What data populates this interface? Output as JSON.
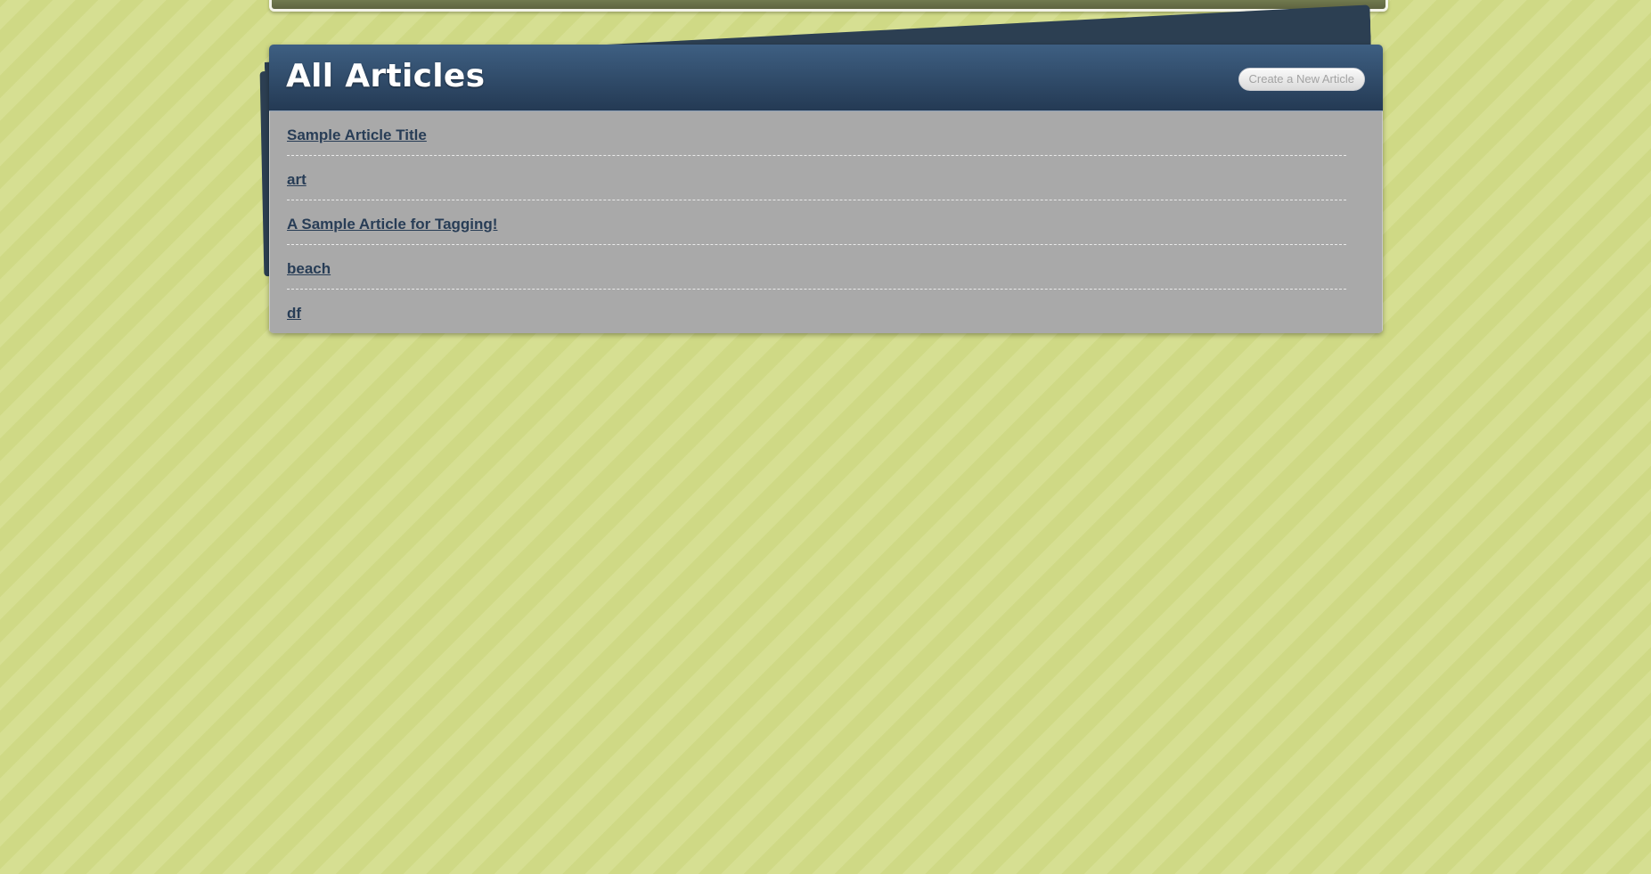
{
  "page": {
    "title": "All Articles",
    "create_button_label": "Create a New Article"
  },
  "articles": [
    {
      "title": "Sample Article Title"
    },
    {
      "title": "art"
    },
    {
      "title": "A Sample Article for Tagging!"
    },
    {
      "title": "beach"
    },
    {
      "title": "df"
    }
  ],
  "colors": {
    "background": "#d3dc8c",
    "header": "#2e4766",
    "panel_body": "#a9a9a9",
    "link": "#283d56"
  }
}
